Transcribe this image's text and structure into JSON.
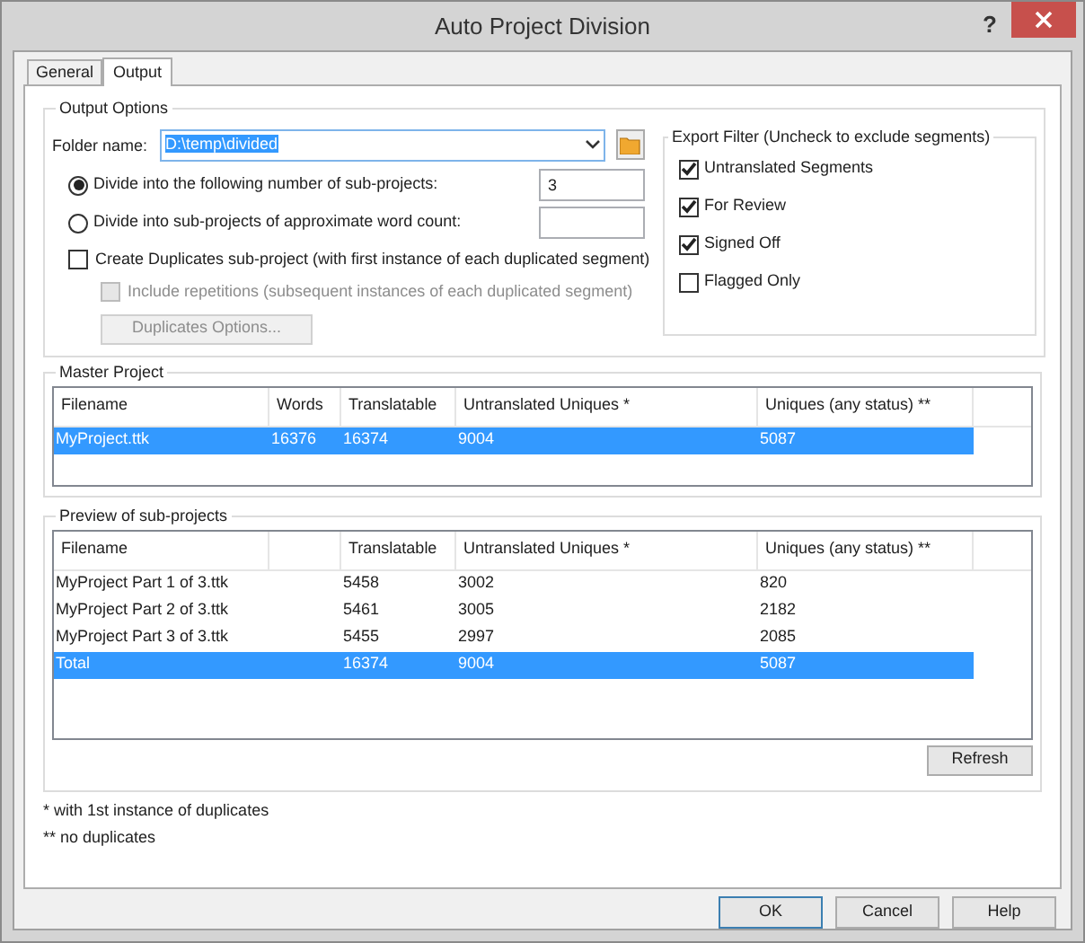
{
  "window": {
    "title": "Auto Project Division",
    "help_glyph": "?"
  },
  "tabs": [
    {
      "label": "General",
      "selected": false
    },
    {
      "label": "Output",
      "selected": true
    }
  ],
  "output_options": {
    "legend": "Output Options",
    "folder_label": "Folder name:",
    "folder_value": "D:\\temp\\divided",
    "folder_value_highlighted": true,
    "divide_options": [
      {
        "label": "Divide into the following number of sub-projects:",
        "selected": true,
        "value": "3"
      },
      {
        "label": "Divide into sub-projects of approximate word count:",
        "selected": false
      }
    ],
    "create_duplicates": {
      "label": "Create Duplicates sub-project (with first instance of each duplicated segment)",
      "checked": false
    },
    "include_repetitions": {
      "label": "Include repetitions (subsequent instances of each duplicated segment)",
      "checked": false,
      "disabled": true
    },
    "duplicates_options_button": {
      "label": "Duplicates Options...",
      "disabled": true
    }
  },
  "export_filter": {
    "legend": "Export Filter (Uncheck to exclude segments)",
    "items": [
      {
        "label": "Untranslated Segments",
        "checked": true
      },
      {
        "label": "For Review",
        "checked": true
      },
      {
        "label": "Signed Off",
        "checked": true
      },
      {
        "label": "Flagged Only",
        "checked": false
      }
    ]
  },
  "master_project": {
    "legend": "Master Project",
    "columns": [
      "Filename",
      "Words",
      "Translatable",
      "Untranslated Uniques *",
      "Uniques (any status) **"
    ],
    "rows": [
      {
        "cells": [
          "MyProject.ttk",
          "16376",
          "16374",
          "9004",
          "5087"
        ],
        "selected": true
      }
    ]
  },
  "preview": {
    "legend": "Preview of sub-projects",
    "columns": [
      "Filename",
      "Translatable",
      "Untranslated Uniques *",
      "Uniques (any status) **"
    ],
    "rows": [
      {
        "cells": [
          "MyProject Part 1 of 3.ttk",
          "5458",
          "3002",
          "820"
        ],
        "selected": false
      },
      {
        "cells": [
          "MyProject Part 2 of 3.ttk",
          "5461",
          "3005",
          "2182"
        ],
        "selected": false
      },
      {
        "cells": [
          "MyProject Part 3 of 3.ttk",
          "5455",
          "2997",
          "2085"
        ],
        "selected": false
      },
      {
        "cells": [
          "Total",
          "16374",
          "9004",
          "5087"
        ],
        "selected": true
      }
    ],
    "refresh_button": "Refresh"
  },
  "footnotes": [
    "* with 1st instance of duplicates",
    "** no duplicates"
  ],
  "buttons": [
    {
      "label": "OK",
      "default": true
    },
    {
      "label": "Cancel",
      "default": false
    },
    {
      "label": "Help",
      "default": false
    }
  ]
}
